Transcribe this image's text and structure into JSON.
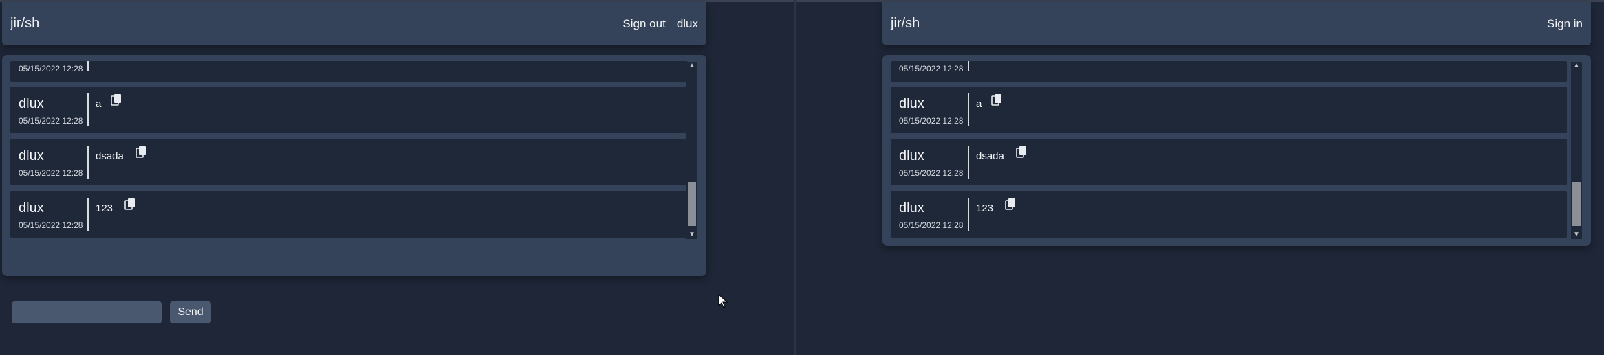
{
  "left_window": {
    "header": {
      "brand": "jir/sh",
      "nav": [
        "Sign out",
        "dlux"
      ]
    },
    "partial_message": {
      "time": "05/15/2022 12:28"
    },
    "messages": [
      {
        "author": "dlux",
        "time": "05/15/2022 12:28",
        "text": "a"
      },
      {
        "author": "dlux",
        "time": "05/15/2022 12:28",
        "text": "dsada"
      },
      {
        "author": "dlux",
        "time": "05/15/2022 12:28",
        "text": "123"
      }
    ],
    "composer": {
      "value": "",
      "placeholder": ""
    },
    "send_label": "Send"
  },
  "right_window": {
    "header": {
      "brand": "jir/sh",
      "nav": [
        "Sign in"
      ]
    },
    "partial_message": {
      "time": "05/15/2022 12:28"
    },
    "messages": [
      {
        "author": "dlux",
        "time": "05/15/2022 12:28",
        "text": "a"
      },
      {
        "author": "dlux",
        "time": "05/15/2022 12:28",
        "text": "dsada"
      },
      {
        "author": "dlux",
        "time": "05/15/2022 12:28",
        "text": "123"
      }
    ]
  },
  "icons": {
    "copy": "copy-icon",
    "pointer": "mouse-pointer-icon"
  },
  "colors": {
    "background": "#1e2637",
    "panel": "#35435a",
    "message": "#1f2839",
    "input": "#4a586f"
  }
}
